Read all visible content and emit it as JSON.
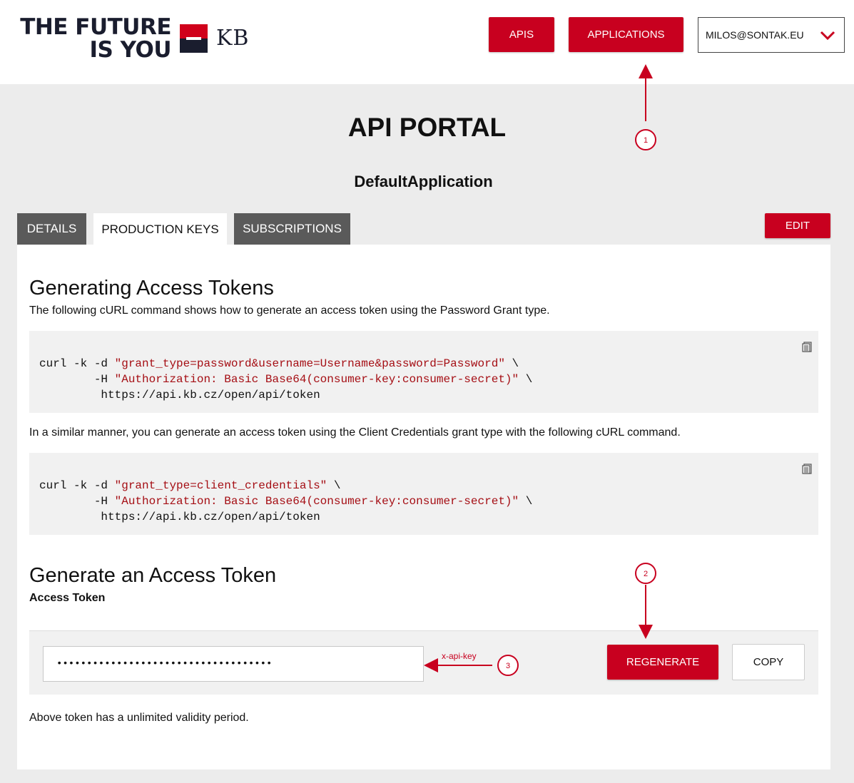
{
  "header": {
    "logo_line1": "THE FUTURE",
    "logo_line2": "IS YOU",
    "logo_brand": "KB",
    "nav_apis": "APIS",
    "nav_applications": "APPLICATIONS",
    "user_email": "MILOS@SONTAK.EU"
  },
  "page": {
    "title": "API PORTAL",
    "app_name": "DefaultApplication"
  },
  "tabs": [
    {
      "label": "DETAILS",
      "active": false
    },
    {
      "label": "PRODUCTION KEYS",
      "active": true
    },
    {
      "label": "SUBSCRIPTIONS",
      "active": false
    }
  ],
  "edit_label": "EDIT",
  "section1": {
    "heading": "Generating Access Tokens",
    "desc": "The following cURL command shows how to generate an access token using the Password Grant type.",
    "code": {
      "line1_cmd": "curl -k -d ",
      "line1_str": "\"grant_type=password&username=Username&password=Password\"",
      "line1_end": " \\",
      "line2_cmd": "        -H ",
      "line2_str": "\"Authorization: Basic Base64(consumer-key:consumer-secret)\"",
      "line2_end": " \\",
      "line3": "         https://api.kb.cz/open/api/token"
    },
    "desc2": "In a similar manner, you can generate an access token using the Client Credentials grant type with the following cURL command.",
    "code2": {
      "line1_cmd": "curl -k -d ",
      "line1_str": "\"grant_type=client_credentials\"",
      "line1_end": " \\",
      "line2_cmd": "        -H ",
      "line2_str": "\"Authorization: Basic Base64(consumer-key:consumer-secret)\"",
      "line2_end": " \\",
      "line3": "         https://api.kb.cz/open/api/token"
    }
  },
  "section2": {
    "heading": "Generate an Access Token",
    "label": "Access Token",
    "token_value": "••••••••••••••••••••••••••••••••••••",
    "regenerate_label": "REGENERATE",
    "copy_label": "COPY",
    "validity_note": "Above token has a unlimited validity period."
  },
  "annotations": {
    "marker1": "1",
    "marker2": "2",
    "marker3": "3",
    "arrow3_label": "x-api-key",
    "color": "#c8001f"
  },
  "colors": {
    "brand_red": "#c8001f",
    "brand_navy": "#1a1d2e",
    "tab_inactive": "#5a5a5a",
    "code_string": "#a50e14"
  }
}
